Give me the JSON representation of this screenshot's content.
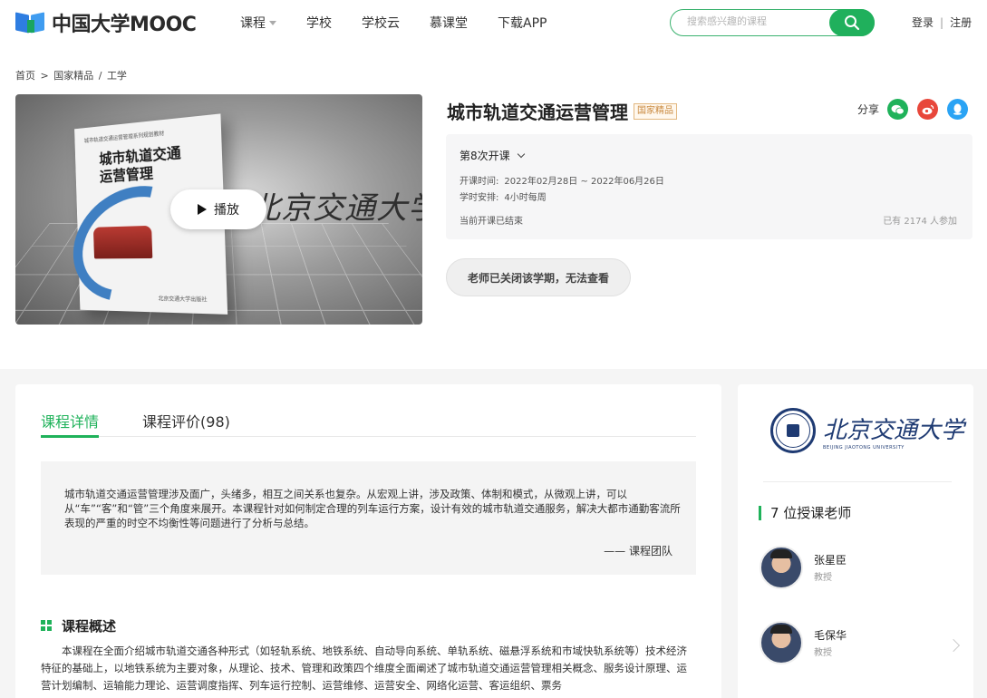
{
  "header": {
    "logo_text": "中国大学MOOC",
    "nav": [
      "课程",
      "学校",
      "学校云",
      "慕课堂",
      "下载APP"
    ],
    "search_placeholder": "搜索感兴趣的课程",
    "login": "登录",
    "register": "注册"
  },
  "breadcrumb": [
    "首页",
    ">",
    "国家精品",
    "/",
    "工学"
  ],
  "video": {
    "play_label": "播放",
    "book_series": "城市轨道交通运营管理系列规划教材",
    "book_title_line1": "城市轨道交通",
    "book_title_line2": "运营管理",
    "school_calligraphy": "北京交通大学",
    "publisher": "北京交通大学出版社"
  },
  "course": {
    "title": "城市轨道交通运营管理",
    "badge": "国家精品",
    "share_label": "分享",
    "term": "第8次开课",
    "time_key": "开课时间:",
    "time_value": "2022年02月28日 ~ 2022年06月26日",
    "hours_key": "学时安排:",
    "hours_value": "4小时每周",
    "status": "当前开课已结束",
    "joined": "已有 2174 人参加",
    "closed_button": "老师已关闭该学期，无法查看"
  },
  "tabs": [
    "课程详情",
    "课程评价(98)"
  ],
  "quote": {
    "text": "城市轨道交通运营管理涉及面广，头绪多，相互之间关系也复杂。从宏观上讲，涉及政策、体制和模式，从微观上讲，可以从“车”“客”和“管”三个角度来展开。本课程针对如何制定合理的列车运行方案，设计有效的城市轨道交通服务，解决大都市通勤客流所表现的严重的时空不均衡性等问题进行了分析与总结。",
    "author": "—— 课程团队"
  },
  "overview": {
    "title": "课程概述",
    "text": "本课程在全面介绍城市轨道交通各种形式（如轻轨系统、地铁系统、自动导向系统、单轨系统、磁悬浮系统和市域快轨系统等）技术经济特征的基础上，以地铁系统为主要对象，从理论、技术、管理和政策四个维度全面阐述了城市轨道交通运营管理相关概念、服务设计原理、运营计划编制、运输能力理论、运营调度指挥、列车运行控制、运营维修、运营安全、网络化运营、客运组织、票务"
  },
  "sidebar": {
    "school_name": "北京交通大学",
    "school_name_en": "BEIJING JIAOTONG UNIVERSITY",
    "teachers_title": "7 位授课老师",
    "teachers": [
      {
        "name": "张星臣",
        "role": "教授"
      },
      {
        "name": "毛保华",
        "role": "教授"
      }
    ]
  },
  "colors": {
    "accent": "#1fb25a",
    "search_button": "#20b05c",
    "badge_text": "#c9893f"
  }
}
